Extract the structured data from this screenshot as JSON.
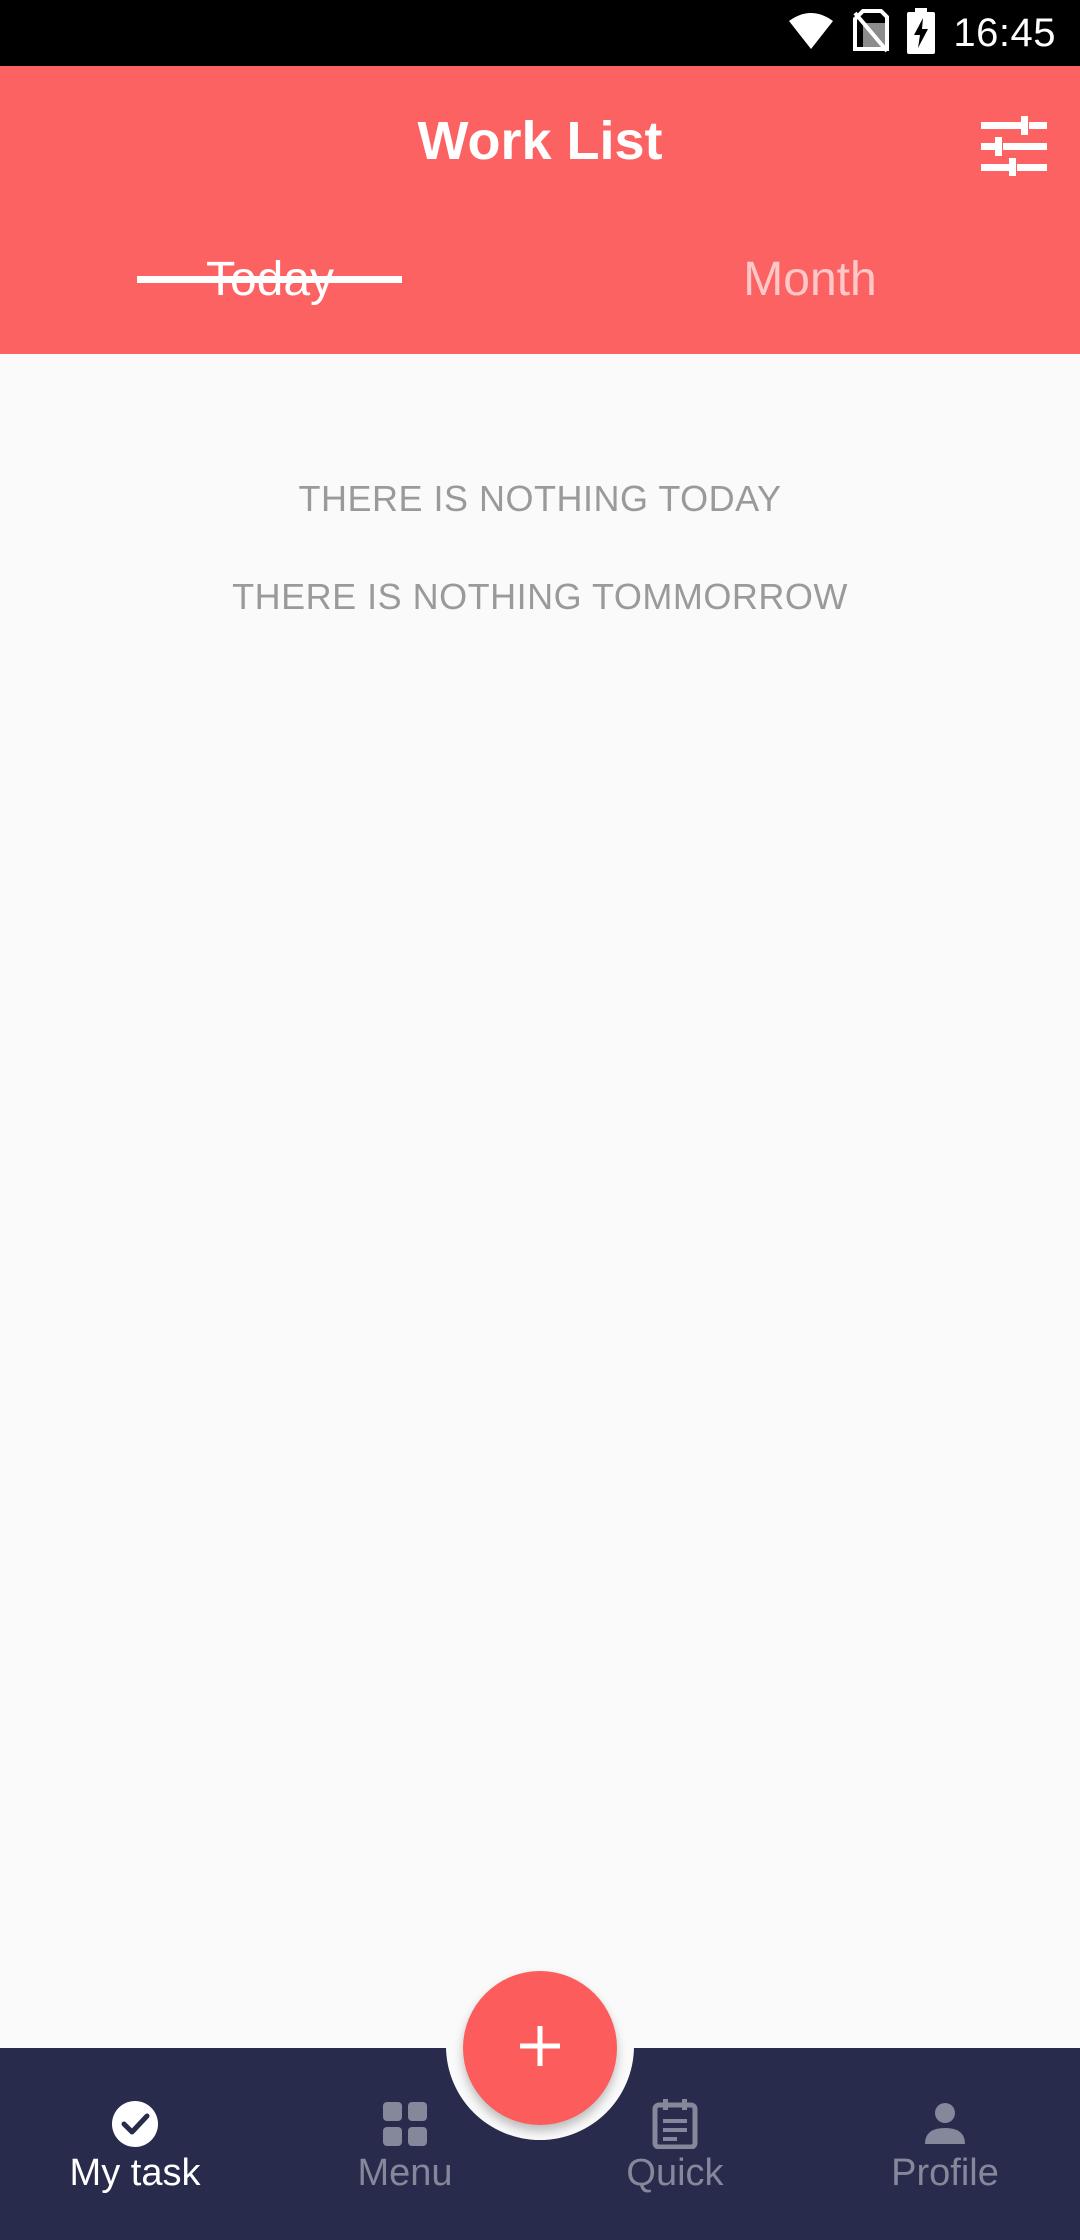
{
  "status_bar": {
    "time": "16:45",
    "icons": [
      "wifi-icon",
      "no-sim-icon",
      "battery-charging-icon"
    ]
  },
  "app_bar": {
    "title": "Work List",
    "filter_icon": "tune-sliders-icon"
  },
  "tabs": [
    {
      "label": "Today",
      "active": true
    },
    {
      "label": "Month",
      "active": false
    }
  ],
  "content": {
    "empty_today": "THERE IS NOTHING TODAY",
    "empty_tomorrow": "THERE IS NOTHING TOMMORROW"
  },
  "fab": {
    "icon": "plus-icon"
  },
  "bottom_nav": {
    "items": [
      {
        "label": "My task",
        "icon": "check-circle-icon",
        "active": true
      },
      {
        "label": "Menu",
        "icon": "grid-icon",
        "active": false
      },
      {
        "label": "Quick",
        "icon": "calendar-note-icon",
        "active": false
      },
      {
        "label": "Profile",
        "icon": "person-icon",
        "active": false
      }
    ]
  },
  "colors": {
    "primary": "#fc6262",
    "nav_background": "#282b4b",
    "nav_inactive": "#85879a",
    "empty_text": "#9a9a9a"
  }
}
